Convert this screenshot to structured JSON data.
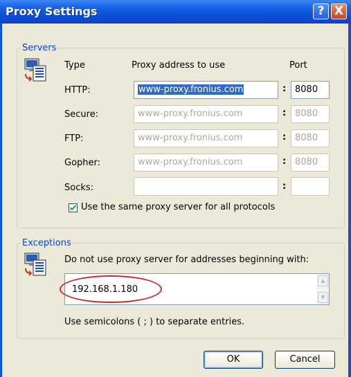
{
  "window": {
    "title": "Proxy Settings",
    "help_label": "?",
    "close_label": "X"
  },
  "servers": {
    "legend": "Servers",
    "headers": {
      "type": "Type",
      "address": "Proxy address to use",
      "port": "Port"
    },
    "rows": [
      {
        "type": "HTTP:",
        "address": "www-proxy.fronius.com",
        "port": "8080"
      },
      {
        "type": "Secure:",
        "address": "www-proxy.fronius.com",
        "port": "8080"
      },
      {
        "type": "FTP:",
        "address": "www-proxy.fronius.com",
        "port": "8080"
      },
      {
        "type": "Gopher:",
        "address": "www-proxy.fronius.com",
        "port": "8080"
      },
      {
        "type": "Socks:",
        "address": "",
        "port": ""
      }
    ],
    "colon": ":",
    "same_proxy_label": "Use the same proxy server for all protocols",
    "same_proxy_checked": true
  },
  "exceptions": {
    "legend": "Exceptions",
    "description": "Do not use proxy server for addresses beginning with:",
    "value": "192.168.1.180",
    "hint": "Use semicolons ( ; ) to separate entries."
  },
  "buttons": {
    "ok": "OK",
    "cancel": "Cancel"
  },
  "icons": {
    "computer": "computer-network-icon",
    "checkmark": "checkmark-icon"
  },
  "colors": {
    "titlebar": "#0a4fd9",
    "legend": "#0046d5",
    "highlight": "#d0262c",
    "selection": "#316ac5"
  }
}
